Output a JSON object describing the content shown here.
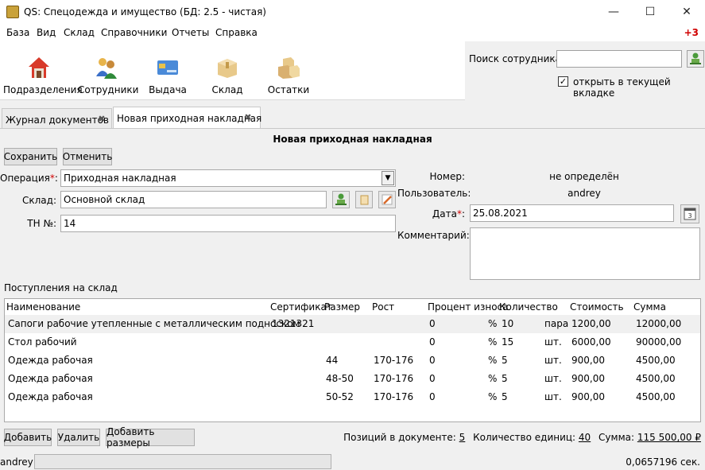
{
  "window": {
    "title": "QS: Спецодежда и имущество (БД: 2.5 - чистая)",
    "min_glyph": "—",
    "max_glyph": "☐",
    "close_glyph": "✕"
  },
  "menu": [
    "База",
    "Вид",
    "Склад",
    "Справочники",
    "Отчеты",
    "Справка"
  ],
  "menu_badge": "+3",
  "toolbar": [
    {
      "label": "Подразделения",
      "icon": "house-icon"
    },
    {
      "label": "Сотрудники",
      "icon": "people-icon"
    },
    {
      "label": "Выдача",
      "icon": "card-icon"
    },
    {
      "label": "Склад",
      "icon": "box-icon"
    },
    {
      "label": "Остатки",
      "icon": "boxes-icon"
    }
  ],
  "search": {
    "label": "Поиск сотрудника:",
    "value": "",
    "open_in_tab_label": "открыть в текущей вкладке",
    "open_in_tab_checked": true
  },
  "tabs": [
    {
      "label": "Журнал документов",
      "active": false
    },
    {
      "label": "Новая приходная накладная",
      "active": true
    }
  ],
  "doc": {
    "title": "Новая приходная накладная",
    "save_label": "Сохранить",
    "cancel_label": "Отменить",
    "operation_label": "Операция",
    "operation_value": "Приходная накладная",
    "warehouse_label": "Склад:",
    "warehouse_value": "Основной склад",
    "tn_label": "ТН №:",
    "tn_value": "14",
    "number_label": "Номер:",
    "number_value": "не определён",
    "user_label": "Пользователь:",
    "user_value": "andrey",
    "date_label": "Дата",
    "date_value": "25.08.2021",
    "comment_label": "Комментарий:",
    "comment_value": "",
    "required_mark": "*",
    "colon": ":"
  },
  "arrivals": {
    "label": "Поступления на склад",
    "columns": [
      "Наименование",
      "Сертификат",
      "Размер",
      "Рост",
      "Процент износа",
      "Количество",
      "Стоимость",
      "Сумма"
    ],
    "rows": [
      {
        "name": "Сапоги рабочие утепленные с металлическим подноском",
        "cert": "1321321",
        "size": "",
        "height": "",
        "wear": "0",
        "pct": "%",
        "qty": "10",
        "unit": "пара",
        "price": "1200,00",
        "sum": "12000,00"
      },
      {
        "name": "Стол рабочий",
        "cert": "",
        "size": "",
        "height": "",
        "wear": "0",
        "pct": "%",
        "qty": "15",
        "unit": "шт.",
        "price": "6000,00",
        "sum": "90000,00"
      },
      {
        "name": "Одежда рабочая",
        "cert": "",
        "size": "44",
        "height": "170-176",
        "wear": "0",
        "pct": "%",
        "qty": "5",
        "unit": "шт.",
        "price": "900,00",
        "sum": "4500,00"
      },
      {
        "name": "Одежда рабочая",
        "cert": "",
        "size": "48-50",
        "height": "170-176",
        "wear": "0",
        "pct": "%",
        "qty": "5",
        "unit": "шт.",
        "price": "900,00",
        "sum": "4500,00"
      },
      {
        "name": "Одежда рабочая",
        "cert": "",
        "size": "50-52",
        "height": "170-176",
        "wear": "0",
        "pct": "%",
        "qty": "5",
        "unit": "шт.",
        "price": "900,00",
        "sum": "4500,00"
      }
    ],
    "add_label": "Добавить",
    "delete_label": "Удалить",
    "add_sizes_label": "Добавить размеры",
    "positions_label": "Позиций в документе:",
    "positions_value": "5",
    "units_label": "Количество единиц:",
    "units_value": "40",
    "total_label": "Сумма:",
    "total_value": "115 500,00 ₽"
  },
  "status": {
    "user": "andrey",
    "time": "0,0657196 сек."
  }
}
